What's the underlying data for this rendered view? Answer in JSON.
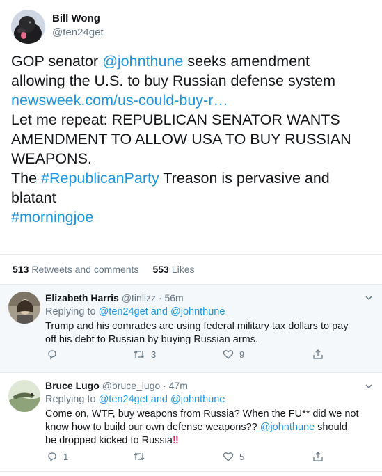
{
  "tweet": {
    "author_name": "Bill Wong",
    "author_handle": "@ten24get",
    "text_lines": [
      [
        {
          "t": "GOP senator "
        },
        {
          "t": "@johnthune",
          "link": true
        },
        {
          "t": "  seeks amendment"
        }
      ],
      [
        {
          "t": "allowing the U.S. to buy Russian defense system"
        }
      ],
      [
        {
          "t": "newsweek.com/us-could-buy-r…",
          "link": true
        }
      ],
      [
        {
          "t": "Let me repeat: REPUBLICAN SENATOR WANTS"
        }
      ],
      [
        {
          "t": "AMENDMENT TO ALLOW USA TO BUY RUSSIAN"
        }
      ],
      [
        {
          "t": "WEAPONS."
        }
      ],
      [
        {
          "t": "The "
        },
        {
          "t": "#RepublicanParty",
          "link": true
        },
        {
          "t": " Treason is pervasive and"
        }
      ],
      [
        {
          "t": "blatant"
        }
      ],
      [
        {
          "t": "#morningjoe",
          "link": true
        }
      ]
    ],
    "retweets_count": "513",
    "retweets_label": "Retweets and comments",
    "likes_count": "553",
    "likes_label": "Likes"
  },
  "replies": [
    {
      "name": "Elizabeth Harris",
      "handle": "@tinlizz",
      "time": "· 56m",
      "replying_prefix": "Replying to",
      "replying_to_1": "@ten24get",
      "replying_and": "and",
      "replying_to_2": "@johnthune",
      "body_lines": [
        [
          {
            "t": "Trump and his comrades are using federal military tax dollars to pay"
          }
        ],
        [
          {
            "t": "off his debt to Russian by buying Russian arms."
          }
        ]
      ],
      "reply_count": "",
      "retweet_count": "3",
      "like_count": "9"
    },
    {
      "name": "Bruce Lugo",
      "handle": "@bruce_lugo",
      "time": "· 47m",
      "replying_prefix": "Replying to",
      "replying_to_1": "@ten24get",
      "replying_and": "and",
      "replying_to_2": "@johnthune",
      "body_lines": [
        [
          {
            "t": "Come on, WTF, buy weapons from Russia? When the FU** did we not"
          }
        ],
        [
          {
            "t": "know how to build our own defense weapons?? "
          },
          {
            "t": "@johnthune",
            "link": true
          },
          {
            "t": "  should"
          }
        ],
        [
          {
            "t": "be dropped kicked to Russia"
          },
          {
            "t": "‼",
            "bang": true
          }
        ]
      ],
      "reply_count": "1",
      "retweet_count": "",
      "like_count": "5"
    }
  ],
  "colors": {
    "link": "#1b95e0",
    "muted": "#657786",
    "reply_bg": "#f5f8fa",
    "emphasis": "#e0245e"
  },
  "icons": [
    "reply-icon",
    "retweet-icon",
    "like-icon",
    "share-icon",
    "chevron-down-icon"
  ]
}
